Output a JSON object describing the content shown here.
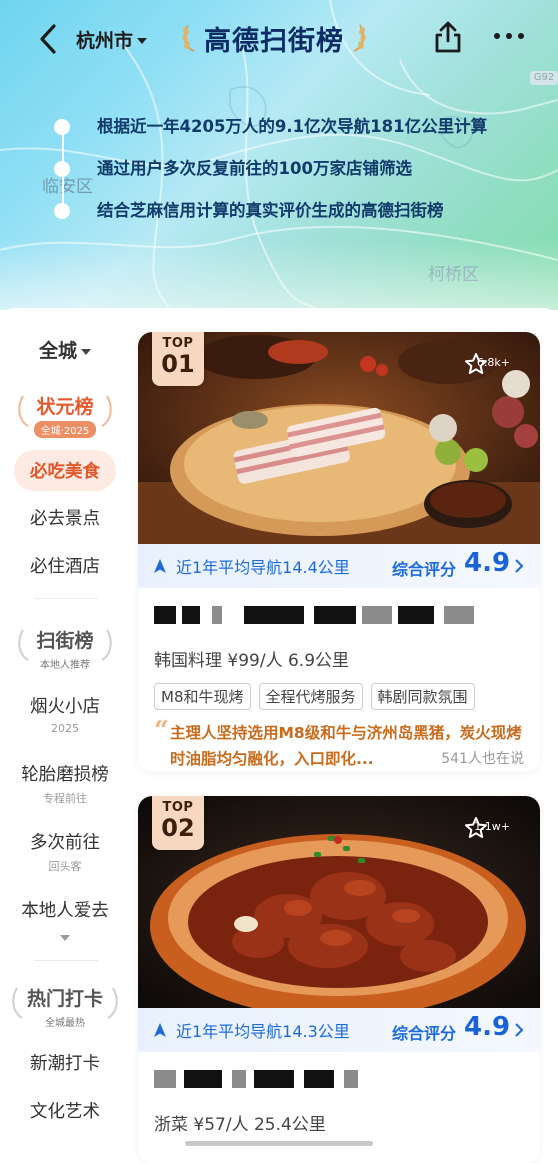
{
  "header": {
    "city": "杭州市",
    "brand_title": "高德扫街榜",
    "map_labels": [
      "临安区",
      "柯桥区",
      "G92"
    ]
  },
  "facts": [
    "根据近一年4205万人的9.1亿次导航181亿公里计算",
    "通过用户多次反复前往的100万家店铺筛选",
    "结合芝麻信用计算的真实评价生成的高德扫街榜"
  ],
  "nav": {
    "scope": "全城",
    "groups": [
      {
        "title": "状元榜",
        "sub": "全城·2025",
        "color": "#e25b2e"
      },
      {
        "title": "扫街榜",
        "sub": "本地人推荐",
        "color": "#555555"
      },
      {
        "title": "热门打卡",
        "sub": "全城最热",
        "color": "#555555"
      }
    ],
    "items": [
      {
        "label": "必吃美食",
        "sub": ""
      },
      {
        "label": "必去景点",
        "sub": ""
      },
      {
        "label": "必住酒店",
        "sub": ""
      },
      {
        "label": "烟火小店",
        "sub": "2025"
      },
      {
        "label": "轮胎磨损榜",
        "sub": "专程前往"
      },
      {
        "label": "多次前往",
        "sub": "回头客"
      },
      {
        "label": "本地人爱去",
        "sub": ""
      },
      {
        "label": "新潮打卡",
        "sub": ""
      },
      {
        "label": "文化艺术",
        "sub": ""
      }
    ]
  },
  "cards": [
    {
      "rank_label": "TOP",
      "rank": "01",
      "fav_count": "6.8k+",
      "distance_label": "近1年平均导航14.4公里",
      "score_label": "综合评分",
      "score": "4.9",
      "meta": "韩国料理 ¥99/人 6.9公里",
      "tags": [
        "M8和牛现烤",
        "全程代烤服务",
        "韩剧同款氛围"
      ],
      "review": "主理人坚持选用M8级和牛与济州岛黑猪，炭火现烤时油脂均匀融化，入口即化...",
      "review_count": "541人也在说"
    },
    {
      "rank_label": "TOP",
      "rank": "02",
      "fav_count": "1.1w+",
      "distance_label": "近1年平均导航14.3公里",
      "score_label": "综合评分",
      "score": "4.9",
      "meta": "浙菜 ¥57/人 25.4公里"
    }
  ],
  "colors": {
    "accent_orange": "#e0582a",
    "accent_blue": "#1d6ad8",
    "badge_peach": "#f7d7bf",
    "review_orange": "#c96b1d"
  },
  "icons": [
    "back-arrow-icon",
    "share-icon",
    "more-icon",
    "laurel-icon",
    "star-icon",
    "navigation-arrow-icon",
    "chevron-right-icon",
    "quote-icon"
  ]
}
